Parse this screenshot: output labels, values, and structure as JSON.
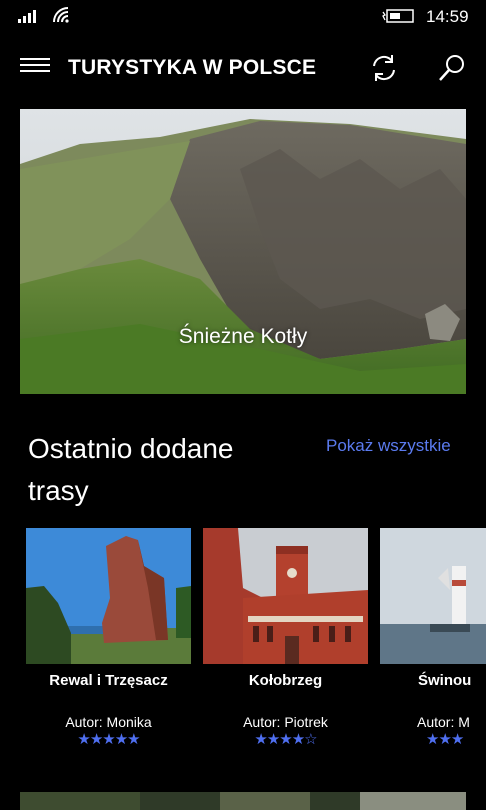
{
  "status_bar": {
    "time": "14:59"
  },
  "app_bar": {
    "title": "TURYSTYKA W POLSCE"
  },
  "hero": {
    "caption": "Śnieżne Kotły"
  },
  "section": {
    "title": "Ostatnio dodane trasy",
    "show_all": "Pokaż wszystkie"
  },
  "routes": [
    {
      "name": "Rewal i Trzęsacz",
      "author": "Autor: Monika",
      "rating": 5,
      "stars": "★★★★★"
    },
    {
      "name": "Kołobrzeg",
      "author": "Autor: Piotrek",
      "rating": 4,
      "stars": "★★★★☆"
    },
    {
      "name": "Świnou",
      "author": "Autor: M",
      "rating": 3,
      "stars": "★★★"
    }
  ],
  "colors": {
    "accent": "#5b7bef",
    "star": "#4f6ff0",
    "background": "#000000"
  }
}
